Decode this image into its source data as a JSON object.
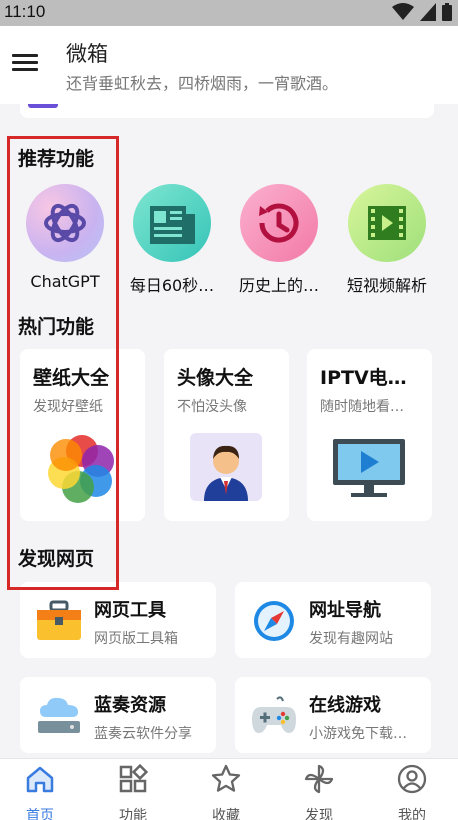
{
  "status_bar": {
    "time": "11:10"
  },
  "app_bar": {
    "title": "微箱",
    "subtitle": "还背垂虹秋去，四桥烟雨，一宵歌酒。"
  },
  "sections": {
    "recommended": "推荐功能",
    "hot": "热门功能",
    "discover": "发现网页"
  },
  "recommended": [
    {
      "label": "ChatGPT",
      "icon": "openai-icon"
    },
    {
      "label": "每日60秒…",
      "icon": "newspaper-icon"
    },
    {
      "label": "历史上的…",
      "icon": "history-icon"
    },
    {
      "label": "短视频解析",
      "icon": "video-icon"
    }
  ],
  "hot": [
    {
      "title": "壁纸大全",
      "subtitle": "发现好壁纸",
      "icon": "color-petals-icon"
    },
    {
      "title": "头像大全",
      "subtitle": "不怕没头像",
      "icon": "avatar-person-icon"
    },
    {
      "title": "IPTV电…",
      "subtitle": "随时随地看…",
      "icon": "tv-play-icon"
    }
  ],
  "discover": [
    {
      "title": "网页工具",
      "subtitle": "网页版工具箱",
      "icon": "toolbox-icon"
    },
    {
      "title": "网址导航",
      "subtitle": "发现有趣网站",
      "icon": "compass-icon"
    },
    {
      "title": "蓝奏资源",
      "subtitle": "蓝奏云软件分享",
      "icon": "cloud-server-icon"
    },
    {
      "title": "在线游戏",
      "subtitle": "小游戏免下载…",
      "icon": "gamepad-icon"
    }
  ],
  "bottom_nav": [
    {
      "label": "首页",
      "icon": "home-icon",
      "active": true
    },
    {
      "label": "功能",
      "icon": "grid-icon",
      "active": false
    },
    {
      "label": "收藏",
      "icon": "star-icon",
      "active": false
    },
    {
      "label": "发现",
      "icon": "pinwheel-icon",
      "active": false
    },
    {
      "label": "我的",
      "icon": "profile-icon",
      "active": false
    }
  ],
  "colors": {
    "accent": "#3a7be0",
    "highlight_box": "#d62828",
    "nav_inactive": "#555555"
  }
}
